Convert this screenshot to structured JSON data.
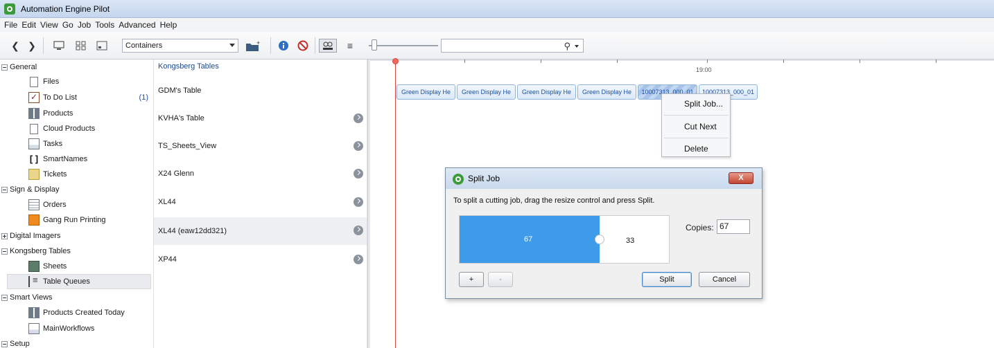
{
  "window": {
    "title": "Automation Engine Pilot"
  },
  "menu": [
    "File",
    "Edit",
    "View",
    "Go",
    "Job",
    "Tools",
    "Advanced",
    "Help"
  ],
  "toolbar": {
    "view_combo_value": "Containers",
    "search_value": "",
    "search_icon": "search-icon"
  },
  "tree": {
    "categories": {
      "general": "General",
      "sign_display": "Sign & Display",
      "digital_imagers": "Digital Imagers",
      "kongsberg_tables": "Kongsberg Tables",
      "smart_views": "Smart Views",
      "setup": "Setup"
    },
    "items": {
      "files": "Files",
      "todo": "To Do List",
      "todo_badge": "(1)",
      "products": "Products",
      "cloud_products": "Cloud Products",
      "tasks": "Tasks",
      "smartnames": "SmartNames",
      "tickets": "Tickets",
      "orders": "Orders",
      "gang_run": "Gang Run Printing",
      "sheets": "Sheets",
      "table_queues": "Table Queues",
      "products_today": "Products Created Today",
      "main_workflows": "MainWorkflows"
    }
  },
  "queues": {
    "header": "Kongsberg Tables",
    "rows": [
      "GDM's Table",
      "KVHA's Table",
      "TS_Sheets_View",
      "X24 Glenn",
      "XL44",
      "XL44 (eaw12dd321)",
      "XP44"
    ]
  },
  "timeline": {
    "time_label": "19:00",
    "jobs": [
      "Green Display He",
      "Green Display He",
      "Green Display He",
      "Green Display He",
      "10007313_000_01",
      "10007313_000_01"
    ]
  },
  "context_menu": {
    "split": "Split Job...",
    "cut_next": "Cut Next",
    "delete": "Delete"
  },
  "dialog": {
    "title": "Split Job",
    "close": "X",
    "instruction": "To split a cutting job, drag the resize control and press Split.",
    "left_value": "67",
    "right_value": "33",
    "split_fraction": 0.67,
    "copies_label": "Copies:",
    "copies_value": "67",
    "plus": "+",
    "minus": "-",
    "split_btn": "Split",
    "cancel_btn": "Cancel"
  }
}
